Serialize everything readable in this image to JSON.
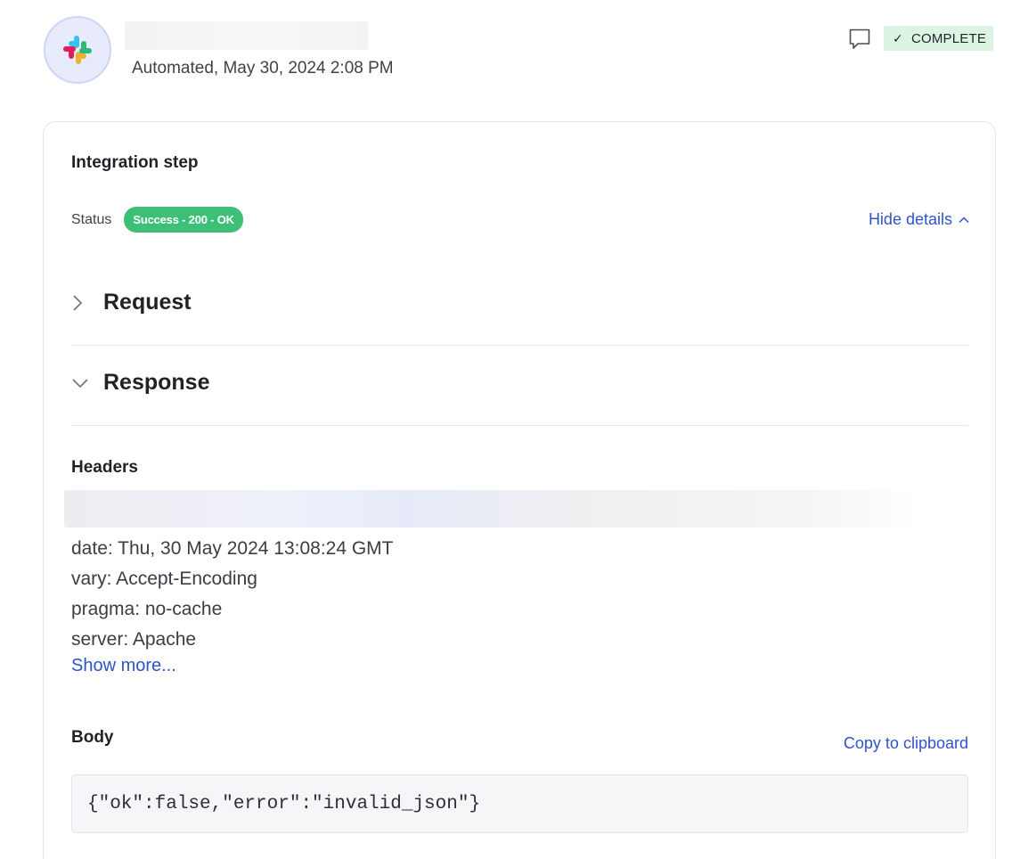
{
  "event": {
    "subtitle": "Automated, May 30, 2024 2:08 PM",
    "status_badge": "COMPLETE",
    "icons": {
      "app_logo": "slack-logo",
      "comment": "comment-icon",
      "check": "check-icon"
    }
  },
  "integration": {
    "title": "Integration step",
    "status_label": "Status",
    "status_value": "Success - 200 - OK",
    "hide_details": "Hide details"
  },
  "request": {
    "label": "Request",
    "expanded": false
  },
  "response": {
    "label": "Response",
    "expanded": true,
    "headers_title": "Headers",
    "headers": [
      "date: Thu, 30 May 2024 13:08:24 GMT",
      "vary: Accept-Encoding",
      "pragma: no-cache",
      "server: Apache"
    ],
    "show_more": "Show more...",
    "body_title": "Body",
    "copy_label": "Copy to clipboard",
    "body": "{\"ok\":false,\"error\":\"invalid_json\"}"
  },
  "colors": {
    "link": "#2d55c9",
    "success_pill": "#3dbf78",
    "complete_bg": "#dcf5e3",
    "avatar_bg": "#e7ebfb"
  }
}
